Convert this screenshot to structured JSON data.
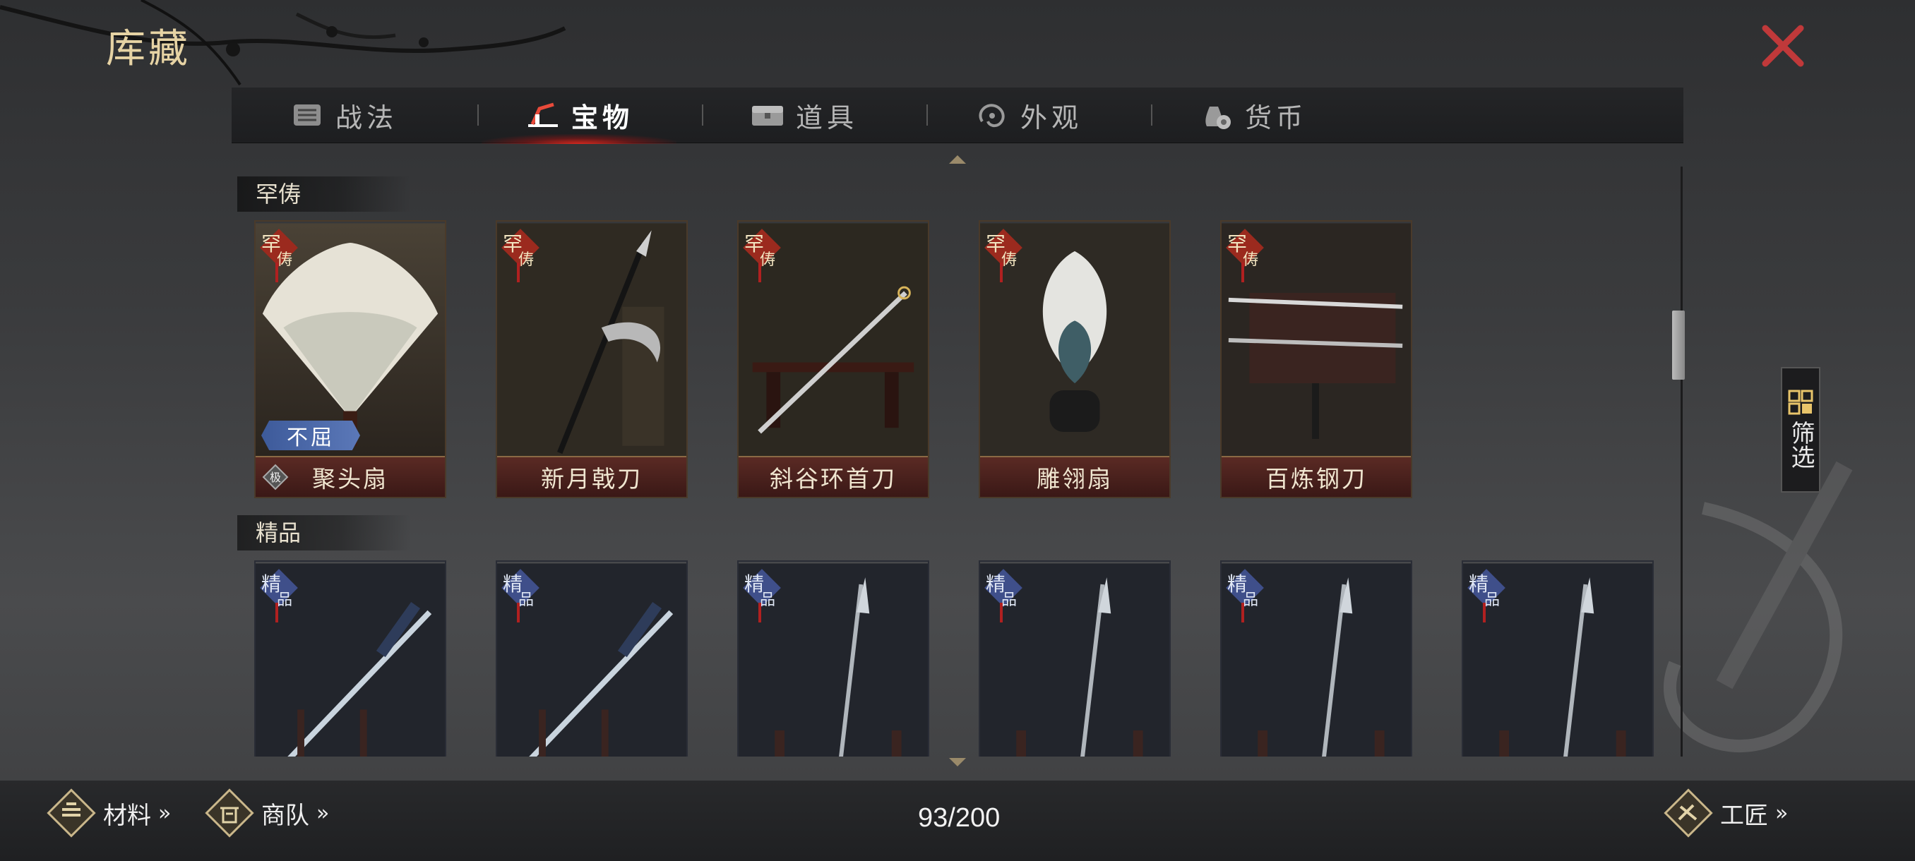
{
  "page": {
    "title": "库藏"
  },
  "tabs": [
    {
      "label": "战法",
      "icon": "scroll-icon",
      "active": false
    },
    {
      "label": "宝物",
      "icon": "treasure-icon",
      "active": true
    },
    {
      "label": "道具",
      "icon": "chest-icon",
      "active": false
    },
    {
      "label": "外观",
      "icon": "appearance-icon",
      "active": false
    },
    {
      "label": "货币",
      "icon": "money-bag-icon",
      "active": false
    }
  ],
  "sections": [
    {
      "label": "罕俦",
      "tag": [
        "罕",
        "俦"
      ],
      "items": [
        {
          "name": "聚头扇",
          "badge": "不屈",
          "grade": "极"
        },
        {
          "name": "新月戟刀"
        },
        {
          "name": "斜谷环首刀"
        },
        {
          "name": "雕翎扇"
        },
        {
          "name": "百炼钢刀"
        }
      ]
    },
    {
      "label": "精品",
      "tag": [
        "精",
        "品"
      ],
      "items": [
        {
          "name": ""
        },
        {
          "name": ""
        },
        {
          "name": ""
        },
        {
          "name": ""
        },
        {
          "name": ""
        },
        {
          "name": ""
        }
      ]
    }
  ],
  "filter": {
    "label": "筛选"
  },
  "bottom": {
    "materials": "材料",
    "caravan": "商队",
    "craftsman": "工匠",
    "chevron": "»",
    "count": "93/200"
  },
  "colors": {
    "accent_gold": "#e6d3a4",
    "close_red": "#c0393a",
    "tab_active_glow": "#dc281e"
  }
}
